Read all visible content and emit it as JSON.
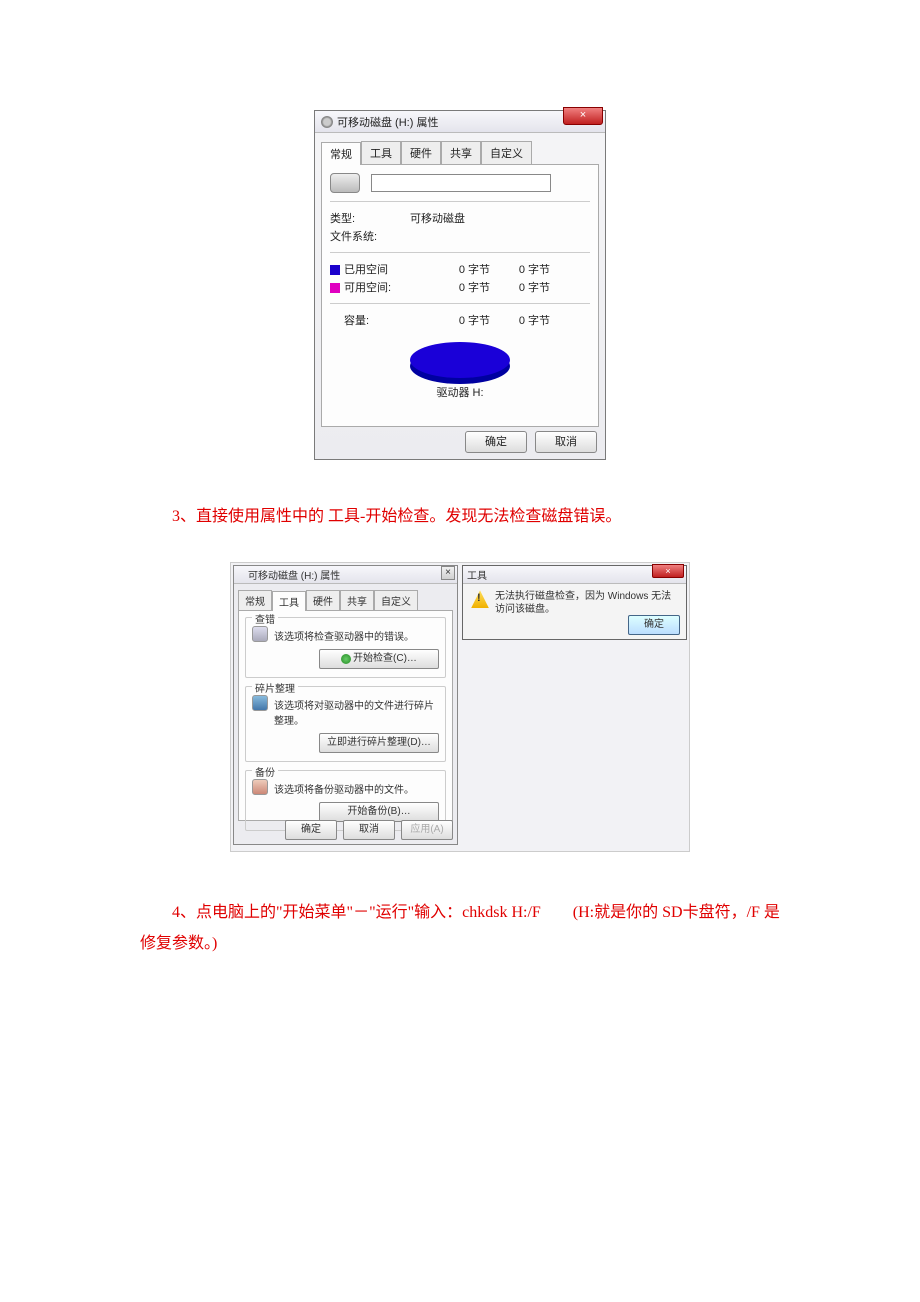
{
  "dialog1": {
    "title": "可移动磁盘 (H:) 属性",
    "close": "×",
    "tabs": [
      "常规",
      "工具",
      "硬件",
      "共享",
      "自定义"
    ],
    "type_label": "类型:",
    "type_value": "可移动磁盘",
    "fs_label": "文件系统:",
    "used_label": "已用空间",
    "free_label": "可用空间:",
    "used_bytes": "0 字节",
    "used_bytes2": "0 字节",
    "free_bytes": "0 字节",
    "free_bytes2": "0 字节",
    "capacity_label": "容量:",
    "capacity_bytes": "0 字节",
    "capacity_bytes2": "0 字节",
    "drive_label": "驱动器 H:",
    "ok": "确定",
    "cancel": "取消"
  },
  "para3": "3、直接使用属性中的 工具-开始检查。发现无法检查磁盘错误。",
  "dialog2": {
    "title": "可移动磁盘 (H:) 属性",
    "close": "×",
    "tabs": [
      "常规",
      "工具",
      "硬件",
      "共享",
      "自定义"
    ],
    "g_error": {
      "legend": "查错",
      "desc": "该选项将检查驱动器中的错误。",
      "btn": "开始检查(C)…"
    },
    "g_defrag": {
      "legend": "碎片整理",
      "desc": "该选项将对驱动器中的文件进行碎片整理。",
      "btn": "立即进行碎片整理(D)…"
    },
    "g_backup": {
      "legend": "备份",
      "desc": "该选项将备份驱动器中的文件。",
      "btn": "开始备份(B)…"
    },
    "ok": "确定",
    "cancel": "取消",
    "apply": "应用(A)"
  },
  "errpop": {
    "title": "工具",
    "close": "×",
    "msg": "无法执行磁盘检查，因为 Windows 无法访问该磁盘。",
    "ok": "确定"
  },
  "para4": "4、点电脑上的\"开始菜单\"－\"运行\"输入：chkdsk H:/F　　(H:就是你的 SD卡盘符，/F 是修复参数。)"
}
